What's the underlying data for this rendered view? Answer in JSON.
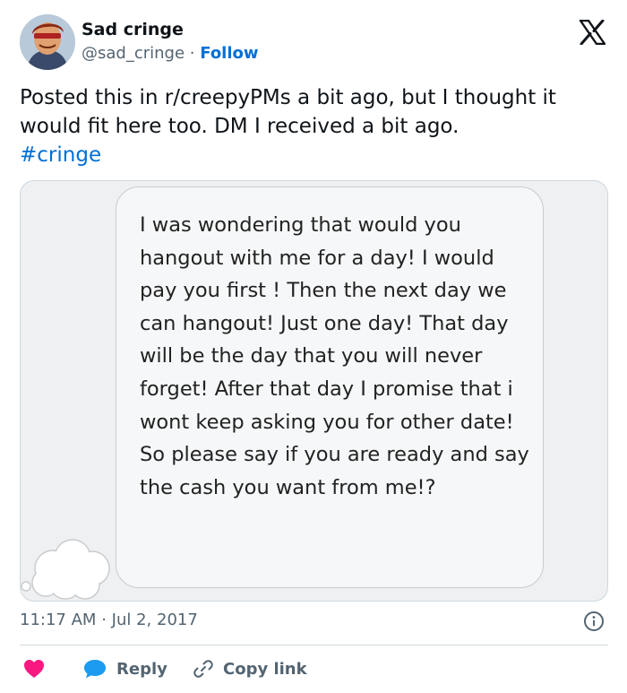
{
  "author": {
    "display_name": "Sad cringe",
    "handle": "@sad_cringe",
    "separator": "·",
    "follow_label": "Follow"
  },
  "tweet": {
    "text": "Posted this in r/creepyPMs a bit ago, but I thought it would fit here too. DM I received a bit ago.",
    "hashtag": "#cringe"
  },
  "media": {
    "message_text": "I was wondering that would you hangout with me for a day! I would pay you first ! Then the next day we can hangout! Just one day! That day will be the day that you will never forget! After that day I promise that i wont keep asking you for other date! So please say if you are ready and say the cash you want from me!?"
  },
  "meta": {
    "time": "11:17 AM",
    "separator": "·",
    "date": "Jul 2, 2017"
  },
  "actions": {
    "reply_label": "Reply",
    "copy_link_label": "Copy link"
  },
  "colors": {
    "accent_blue": "#006fd6",
    "like_pink": "#f91880",
    "reply_blue": "#1d9bf0",
    "secondary_text": "#536471"
  },
  "icons": [
    "x-logo-icon",
    "info-icon",
    "heart-icon",
    "reply-bubble-icon",
    "link-icon",
    "thought-cloud-icon"
  ]
}
